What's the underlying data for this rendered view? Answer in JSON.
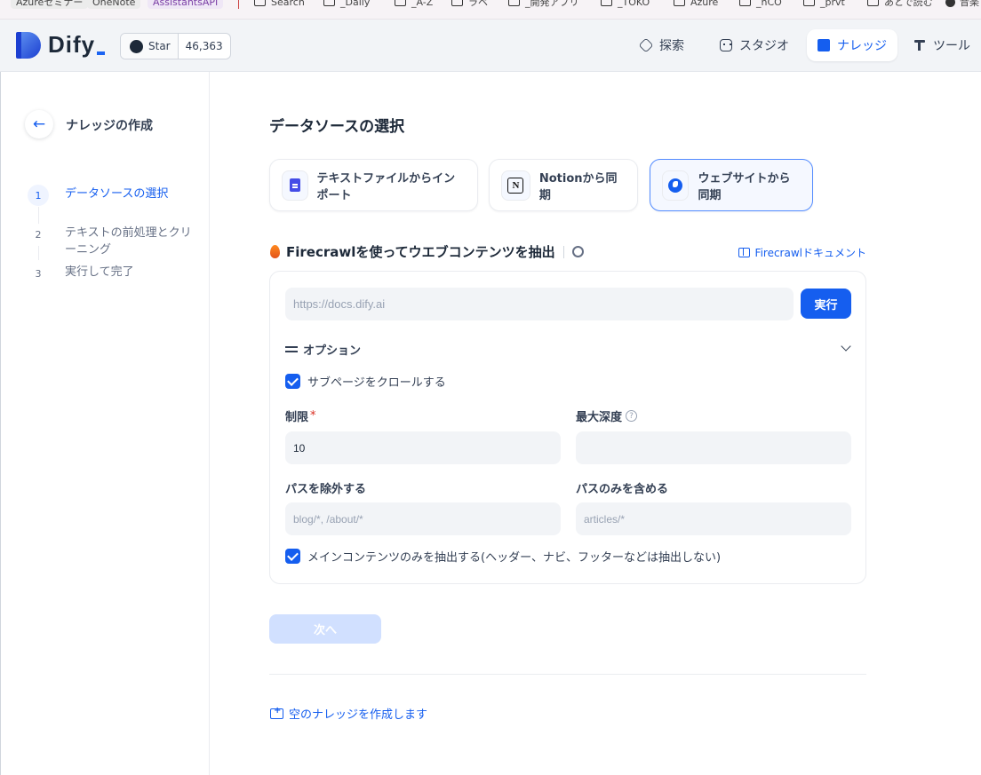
{
  "bookmarks": [
    {
      "label": "Azureセミナー",
      "type": "chip"
    },
    {
      "label": "OneNote",
      "type": "chip"
    },
    {
      "label": "AssistantsAPI",
      "type": "chip-purple"
    },
    {
      "label": "Search",
      "type": "folder"
    },
    {
      "label": "_Daily",
      "type": "folder"
    },
    {
      "label": "_A-Z",
      "type": "folder"
    },
    {
      "label": "ラベ",
      "type": "folder"
    },
    {
      "label": "_開発アプリ",
      "type": "folder"
    },
    {
      "label": "_TOKO",
      "type": "folder"
    },
    {
      "label": "Azure",
      "type": "folder"
    },
    {
      "label": "_nCO",
      "type": "folder"
    },
    {
      "label": "_prvt",
      "type": "folder"
    },
    {
      "label": "あとで読む",
      "type": "folder"
    },
    {
      "label": "音楽",
      "type": "globe"
    }
  ],
  "header": {
    "logo_text": "Dify",
    "github": {
      "star_label": "Star",
      "count": "46,363"
    },
    "nav": [
      {
        "label": "探索",
        "icon": "explore-icon",
        "active": false
      },
      {
        "label": "スタジオ",
        "icon": "robot-icon",
        "active": false
      },
      {
        "label": "ナレッジ",
        "icon": "book-icon",
        "active": true
      },
      {
        "label": "ツール",
        "icon": "tools-icon",
        "active": false
      }
    ]
  },
  "sidebar": {
    "back_icon": "arrow-left-icon",
    "title": "ナレッジの作成",
    "steps": [
      {
        "num": "1",
        "label": "データソースの選択",
        "active": true
      },
      {
        "num": "2",
        "label": "テキストの前処理とクリーニング",
        "active": false
      },
      {
        "num": "3",
        "label": "実行して完了",
        "active": false
      }
    ]
  },
  "main": {
    "section_title": "データソースの選択",
    "sources": [
      {
        "label": "テキストファイルからインポート",
        "icon": "file-icon",
        "active": false
      },
      {
        "label": "Notionから同期",
        "icon": "notion-icon",
        "active": false
      },
      {
        "label": "ウェブサイトから同期",
        "icon": "globe-icon",
        "active": true
      }
    ],
    "firecrawl": {
      "title": "Firecrawlを使ってウエブコンテンツを抽出",
      "doc_link": "Firecrawlドキュメント",
      "url_placeholder": "https://docs.dify.ai",
      "run_label": "実行",
      "options_label": "オプション",
      "crawl_subpages": {
        "label": "サブページをクロールする",
        "checked": true
      },
      "limit": {
        "label": "制限",
        "required_mark": "*",
        "value": "10"
      },
      "max_depth": {
        "label": "最大深度",
        "value": ""
      },
      "exclude_paths": {
        "label": "パスを除外する",
        "placeholder": "blog/*, /about/*"
      },
      "include_only": {
        "label": "パスのみを含める",
        "placeholder": "articles/*"
      },
      "main_content_only": {
        "label": "メインコンテンツのみを抽出する(ヘッダー、ナビ、フッターなどは抽出しない)",
        "checked": true
      }
    },
    "next_label": "次へ",
    "empty_knowledge_label": "空のナレッジを作成します"
  }
}
